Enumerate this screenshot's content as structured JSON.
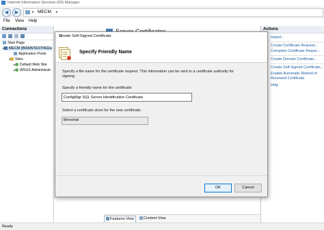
{
  "window": {
    "title": "Internet Information Services (IIS) Manager"
  },
  "address": {
    "separator": "▸",
    "path": "MECM",
    "separator2": "▸"
  },
  "menu": {
    "file": "File",
    "view": "View",
    "help": "Help"
  },
  "connections": {
    "header": "Connections",
    "tree": [
      {
        "label": "Start Page"
      },
      {
        "label": "MECM (BRAINTESTING\\a"
      },
      {
        "label": "Application Pools"
      },
      {
        "label": "Sites"
      },
      {
        "label": "Default Web Site"
      },
      {
        "label": "WSUS Administrati"
      }
    ]
  },
  "main": {
    "header_title": "Server Certificates",
    "tabs": [
      {
        "label": "Features View"
      },
      {
        "label": "Content View"
      }
    ]
  },
  "actions": {
    "header": "Actions",
    "items": [
      {
        "label": "Import..."
      },
      {
        "label": "Create Certificate Request..."
      },
      {
        "label": "Complete Certificate Reque..."
      },
      {
        "label": "Create Domain Certificate..."
      },
      {
        "label": "Create Self-Signed Certificate..."
      },
      {
        "label": "Enable Automatic Rebind of"
      },
      {
        "label": "Renewed Certificate"
      },
      {
        "label": "Help"
      }
    ]
  },
  "dialog": {
    "title": "Create Self-Signed Certificate",
    "close": "✕",
    "heading": "Specify Friendly Name",
    "description_line1": "Specify a file name for the certificate request.  This information can be sent to a certificate authority for",
    "description_line2": "signing:",
    "friendly_label": "Specify a friendly name for the certificate:",
    "friendly_value": "ConfigMgr SQL Server Identification Certificate",
    "store_label": "Select a certificate store for the new certificate:",
    "store_value": "Personal",
    "ok": "OK",
    "cancel": "Cancel"
  },
  "status": {
    "text": "Ready"
  }
}
